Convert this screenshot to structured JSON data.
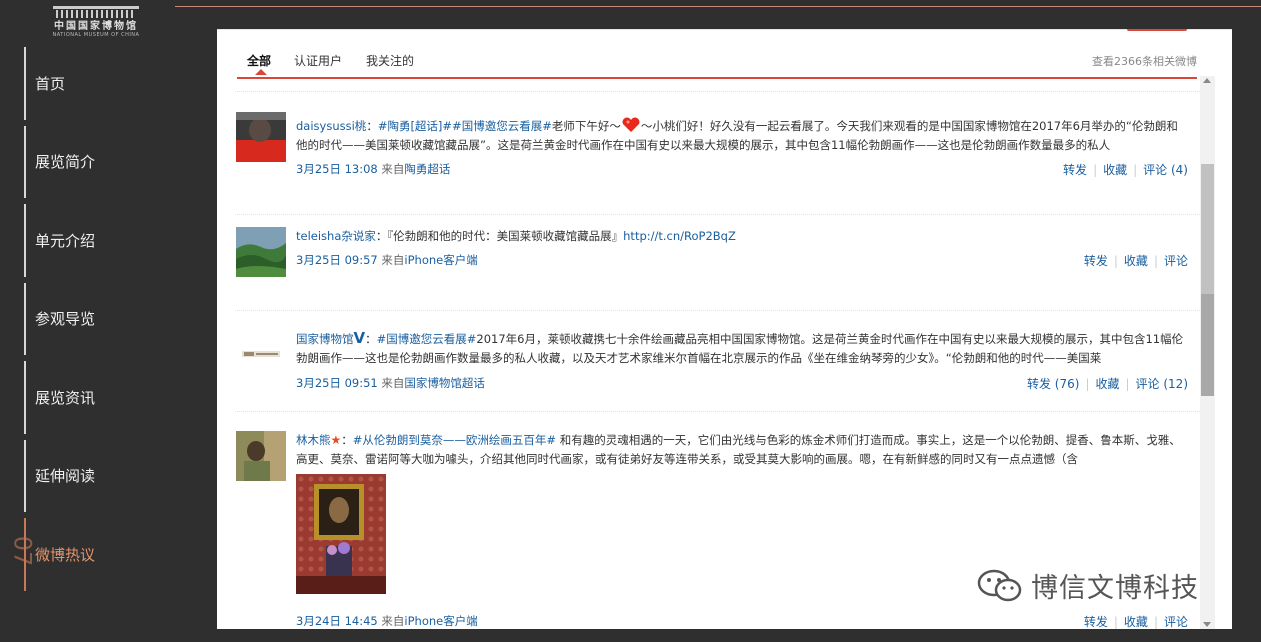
{
  "logo": {
    "cn": "中国国家博物馆",
    "en": "NATIONAL MUSEUM OF CHINA"
  },
  "nav": {
    "items": [
      {
        "label": "首页"
      },
      {
        "label": "展览简介"
      },
      {
        "label": "单元介绍"
      },
      {
        "label": "参观导览"
      },
      {
        "label": "展览资讯"
      },
      {
        "label": "延伸阅读"
      },
      {
        "label": "微博热议"
      }
    ],
    "active_index": 6,
    "active_number": "07"
  },
  "tabs": [
    {
      "label": "全部"
    },
    {
      "label": "认证用户"
    },
    {
      "label": "我关注的"
    }
  ],
  "view_all": "查看2366条相关微博",
  "posts": [
    {
      "user": "daisysussi桃",
      "topic": "#陶勇[超话]##国博邀您云看展#",
      "text_a": "老师下午好～",
      "text_b": "～小桃们好！好久没有一起云看展了。今天我们来观看的是中国国家博物馆在2017年6月举办的“伦勃朗和他的时代——美国莱顿收藏馆藏品展”。这是荷兰黄金时代画作在中国有史以来最大规模的展示，其中包含11幅伦勃朗画作——这也是伦勃朗画作数量最多的私人",
      "time": "3月25日 13:08",
      "from": "来自",
      "source": "陶勇超话",
      "actions": {
        "repost": "转发",
        "fav": "收藏",
        "comment": "评论 (4)"
      }
    },
    {
      "user": "teleisha杂说家",
      "text_a": "：『伦勃朗和他的时代：美国莱顿收藏馆藏品展』",
      "link": "http://t.cn/RoP2BqZ",
      "time": "3月25日 09:57",
      "from": "来自",
      "source": "iPhone客户端",
      "actions": {
        "repost": "转发",
        "fav": "收藏",
        "comment": "评论"
      }
    },
    {
      "user": "国家博物馆",
      "verified": "V",
      "topic": "#国博邀您云看展#",
      "text_a": "2017年6月，莱顿收藏携七十余件绘画藏品亮相中国国家博物馆。这是荷兰黄金时代画作在中国有史以来最大规模的展示，其中包含11幅伦勃朗画作——这也是伦勃朗画作数量最多的私人收藏，以及天才艺术家维米尔首幅在北京展示的作品《坐在维金纳琴旁的少女》。“伦勃朗和他的时代——美国莱",
      "time": "3月25日 09:51",
      "from": "来自",
      "source": "国家博物馆超话",
      "actions": {
        "repost": "转发 (76)",
        "fav": "收藏",
        "comment": "评论 (12)"
      }
    },
    {
      "user": "林木熊",
      "topic": "#从伦勃朗到莫奈——欧洲绘画五百年#",
      "text_a": " 和有趣的灵魂相遇的一天，它们由光线与色彩的炼金术师们打造而成。事实上，这是一个以伦勃朗、提香、鲁本斯、戈雅、高更、莫奈、雷诺阿等大咖为噱头，介绍其他同时代画家，或有徒弟好友等连带关系，或受其莫大影响的画展。嗯，在有新鲜感的同时又有一点点遗憾（含",
      "time": "3月24日 14:45",
      "from": "来自",
      "source": "iPhone客户端",
      "actions": {
        "repost": "转发",
        "fav": "收藏",
        "comment": "评论"
      }
    }
  ],
  "watermark": "博信文博科技"
}
